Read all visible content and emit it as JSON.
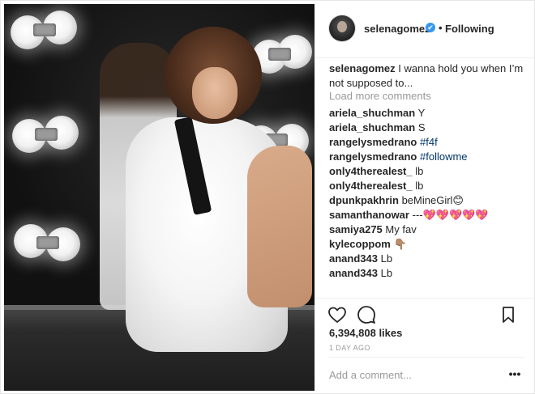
{
  "post": {
    "username": "selenagomez",
    "follow_status": "Following",
    "separator": "•",
    "verified_glyph": "✔"
  },
  "caption": {
    "username": "selenagomez",
    "text": "I wanna hold you when I’m not supposed to..."
  },
  "load_more": "Load more comments",
  "comments": [
    {
      "user": "ariela_shuchman",
      "text": "Y"
    },
    {
      "user": "ariela_shuchman",
      "text": "S"
    },
    {
      "user": "rangelysmedrano",
      "text": "#f4f"
    },
    {
      "user": "rangelysmedrano",
      "text": "#followme"
    },
    {
      "user": "only4therealest_",
      "text": "lb"
    },
    {
      "user": "only4therealest_",
      "text": "lb"
    },
    {
      "user": "dpunkpakhrin",
      "text": "beMineGirl😊"
    },
    {
      "user": "samanthanowar",
      "text": "---💖💖💖💖💖"
    },
    {
      "user": "samiya275",
      "text": "My fav"
    },
    {
      "user": "kylecoppom",
      "text": "👇🏽"
    },
    {
      "user": "anand343",
      "text": "Lb"
    },
    {
      "user": "anand343",
      "text": "Lb"
    }
  ],
  "likes": "6,394,808 likes",
  "timestamp": "1 DAY AGO",
  "add_comment": {
    "placeholder": "Add a comment...",
    "value": ""
  },
  "more_glyph": "•••",
  "icons": {
    "like": "heart-icon",
    "comment": "speech-bubble-icon",
    "save": "bookmark-icon",
    "more": "more-options-icon",
    "verified": "verified-badge-icon"
  },
  "colors": {
    "text": "#262626",
    "muted": "#999999",
    "hashtag": "#003569",
    "verified": "#3897f0",
    "divider": "#efefef"
  }
}
